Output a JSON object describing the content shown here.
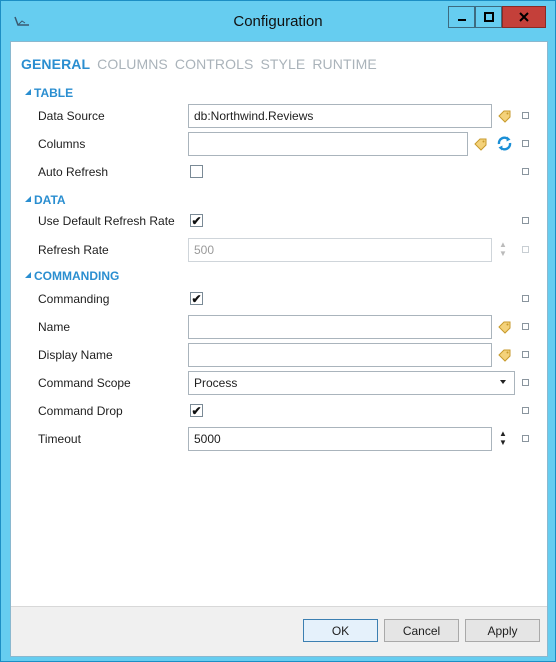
{
  "window": {
    "title": "Configuration"
  },
  "tabs": [
    {
      "label": "GENERAL",
      "active": true
    },
    {
      "label": "COLUMNS",
      "active": false
    },
    {
      "label": "CONTROLS",
      "active": false
    },
    {
      "label": "STYLE",
      "active": false
    },
    {
      "label": "RUNTIME",
      "active": false
    }
  ],
  "sections": {
    "table": "TABLE",
    "data": "DATA",
    "commanding": "COMMANDING"
  },
  "fields": {
    "data_source": {
      "label": "Data Source",
      "value": "db:Northwind.Reviews"
    },
    "columns": {
      "label": "Columns",
      "value": ""
    },
    "auto_refresh": {
      "label": "Auto Refresh",
      "checked": false
    },
    "use_default_refresh_rate": {
      "label": "Use Default Refresh Rate",
      "checked": true
    },
    "refresh_rate": {
      "label": "Refresh Rate",
      "value": "500",
      "disabled": true
    },
    "commanding": {
      "label": "Commanding",
      "checked": true
    },
    "name": {
      "label": "Name",
      "value": ""
    },
    "display_name": {
      "label": "Display Name",
      "value": ""
    },
    "command_scope": {
      "label": "Command Scope",
      "value": "Process"
    },
    "command_drop": {
      "label": "Command Drop",
      "checked": true
    },
    "timeout": {
      "label": "Timeout",
      "value": "5000"
    }
  },
  "glyphs": {
    "check": "✔",
    "spin_up": "▲",
    "spin_down": "▼"
  },
  "buttons": {
    "ok": "OK",
    "cancel": "Cancel",
    "apply": "Apply"
  },
  "icons": [
    "app-icon",
    "minimize-icon",
    "maximize-icon",
    "close-icon",
    "tag-icon",
    "refresh-icon",
    "chevron-down-icon"
  ],
  "colors": {
    "accent": "#2a8ed0",
    "titlebar": "#66cdf0",
    "close": "#c4403a"
  }
}
